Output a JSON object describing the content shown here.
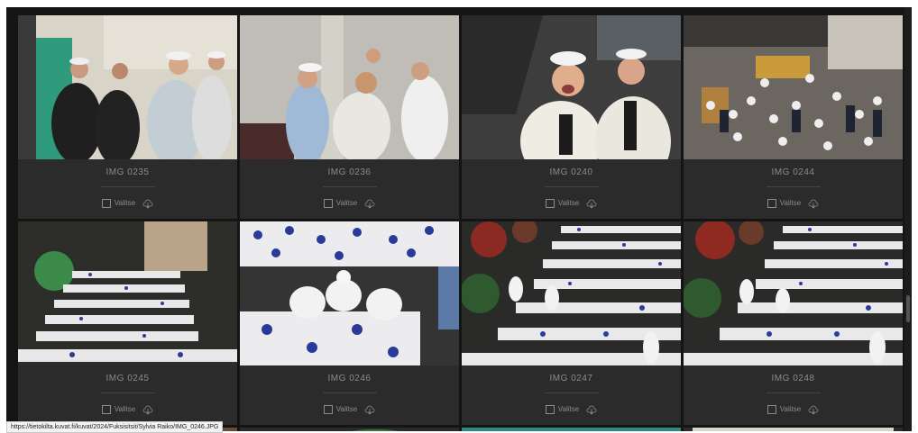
{
  "gallery": {
    "items": [
      {
        "filename": "IMG 0235",
        "select_label": "Valitse",
        "download_icon": "download-icon"
      },
      {
        "filename": "IMG 0236",
        "select_label": "Valitse",
        "download_icon": "download-icon"
      },
      {
        "filename": "IMG 0240",
        "select_label": "Valitse",
        "download_icon": "download-icon"
      },
      {
        "filename": "IMG 0244",
        "select_label": "Valitse",
        "download_icon": "download-icon"
      },
      {
        "filename": "IMG 0245",
        "select_label": "Valitse",
        "download_icon": "download-icon"
      },
      {
        "filename": "IMG 0246",
        "select_label": "Valitse",
        "download_icon": "download-icon"
      },
      {
        "filename": "IMG 0247",
        "select_label": "Valitse",
        "download_icon": "download-icon"
      },
      {
        "filename": "IMG 0248",
        "select_label": "Valitse",
        "download_icon": "download-icon"
      }
    ]
  },
  "status_bar": {
    "url": "https://tietokilta.kuvat.fi/kuvat/2024/Fuksisitsit/Sylvia Raiko/IMG_0246.JPG"
  },
  "colors": {
    "background": "#141414",
    "card": "#2b2b2b",
    "text": "#8b8b8b"
  }
}
